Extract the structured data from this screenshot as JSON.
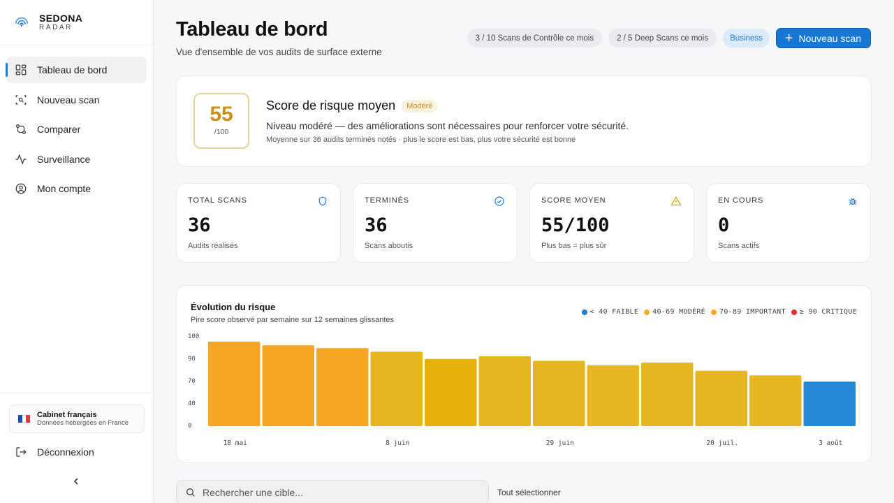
{
  "brand": {
    "name": "SEDONA",
    "tagline": "RADAR"
  },
  "sidebar": {
    "items": [
      {
        "label": "Tableau de bord",
        "icon": "dashboard-icon"
      },
      {
        "label": "Nouveau scan",
        "icon": "scan-icon"
      },
      {
        "label": "Comparer",
        "icon": "compare-icon"
      },
      {
        "label": "Surveillance",
        "icon": "activity-icon"
      },
      {
        "label": "Mon compte",
        "icon": "user-circle-icon"
      }
    ],
    "locale_card": {
      "title": "Cabinet français",
      "subtitle": "Données hébergées en France"
    },
    "logout_label": "Déconnexion"
  },
  "header": {
    "title": "Tableau de bord",
    "subtitle": "Vue d'ensemble de vos audits de surface externe",
    "quota_control": "3 / 10 Scans de Contrôle ce mois",
    "quota_deep": "2 / 5 Deep Scans ce mois",
    "plan": "Business",
    "new_scan_label": "Nouveau scan"
  },
  "risk": {
    "score": "55",
    "denominator": "/100",
    "title": "Score de risque moyen",
    "badge": "Modéré",
    "description": "Niveau modéré — des améliorations sont nécessaires pour renforcer votre sécurité.",
    "note": "Moyenne sur 36 audits terminés notés · plus le score est bas, plus votre sécurité est bonne"
  },
  "stats": [
    {
      "label": "TOTAL SCANS",
      "value": "36",
      "sub": "Audits réalisés",
      "icon": "shield-icon",
      "color": "#1f7bd4"
    },
    {
      "label": "TERMINÉS",
      "value": "36",
      "sub": "Scans aboutis",
      "icon": "check-circle-icon",
      "color": "#1f7bd4"
    },
    {
      "label": "SCORE MOYEN",
      "value": "55/100",
      "sub": "Plus bas = plus sûr",
      "icon": "warning-icon",
      "color": "#d99a1b"
    },
    {
      "label": "EN COURS",
      "value": "0",
      "sub": "Scans actifs",
      "icon": "bug-icon",
      "color": "#1f7bd4"
    }
  ],
  "chart": {
    "title": "Évolution du risque",
    "subtitle": "Pire score observé par semaine sur 12 semaines glissantes",
    "legend": [
      {
        "label": "< 40 FAIBLE",
        "color": "#1f7bd4"
      },
      {
        "label": "40-69 MODÉRÉ",
        "color": "#e9b623"
      },
      {
        "label": "70-89 IMPORTANT",
        "color": "#f5a623"
      },
      {
        "label": "≥ 90 CRITIQUE",
        "color": "#e03131"
      }
    ]
  },
  "chart_data": {
    "type": "bar",
    "title": "Évolution du risque",
    "y_ticks": [
      "100",
      "90",
      "70",
      "40",
      "0"
    ],
    "x_tick_labels": [
      "18 mai",
      "8 juin",
      "29 juin",
      "20 juil.",
      "3 août"
    ],
    "x_tick_positions": [
      0.5,
      3.5,
      6.5,
      9.5,
      11.5
    ],
    "values": [
      93,
      89,
      86,
      82,
      74,
      77,
      72,
      67,
      70,
      61,
      56,
      49
    ],
    "bar_colors": [
      "#f5a623",
      "#f5a623",
      "#f5a623",
      "#e9b623",
      "#e6b00c",
      "#e9b623",
      "#e9b623",
      "#e9b623",
      "#e9b623",
      "#e9b623",
      "#e9b623",
      "#2589d9"
    ],
    "grid": false
  },
  "list": {
    "search_placeholder": "Rechercher une cible...",
    "select_all_label": "Tout sélectionner"
  }
}
